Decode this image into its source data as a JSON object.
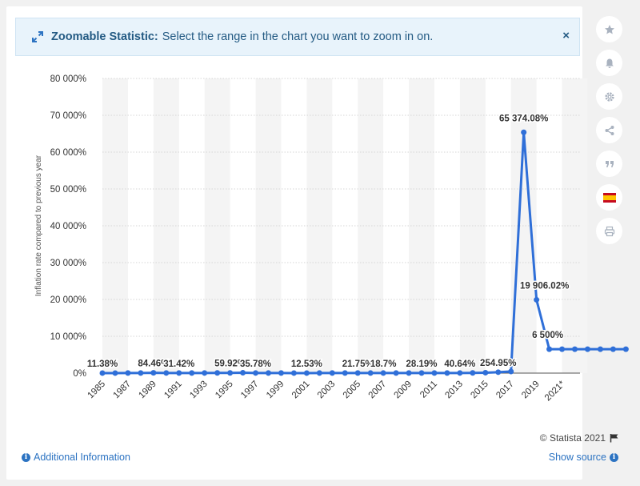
{
  "banner": {
    "title": "Zoomable Statistic:",
    "text": "Select the range in the chart you want to zoom in on.",
    "close_label": "×"
  },
  "sidebar": {
    "icons": [
      "star-icon",
      "bell-icon",
      "gear-icon",
      "share-icon",
      "quote-icon",
      "spain-flag-icon",
      "print-icon"
    ]
  },
  "footer": {
    "credit": "© Statista 2021",
    "additional_info": "Additional Information",
    "show_source": "Show source"
  },
  "colors": {
    "line": "#2f6fd8",
    "band": "#f4f4f4",
    "grid": "#d6d6d6",
    "banner_text": "#235a83",
    "link": "#2c73c2"
  },
  "chart_data": {
    "type": "line",
    "ylabel": "Inflation rate compared to previous year",
    "ylim": [
      0,
      80000
    ],
    "yticks": [
      "0%",
      "10 000%",
      "20 000%",
      "30 000%",
      "40 000%",
      "50 000%",
      "60 000%",
      "70 000%",
      "80 000%"
    ],
    "xtick_labels": [
      "1985",
      "1987",
      "1989",
      "1991",
      "1993",
      "1995",
      "1997",
      "1999",
      "2001",
      "2003",
      "2005",
      "2007",
      "2009",
      "2011",
      "2013",
      "2015",
      "2017",
      "2019",
      "2021*"
    ],
    "categories": [
      "1985",
      "1986",
      "1987",
      "1988",
      "1989",
      "1990",
      "1991",
      "1992",
      "1993",
      "1994",
      "1995",
      "1996",
      "1997",
      "1998",
      "1999",
      "2000",
      "2001",
      "2002",
      "2003",
      "2004",
      "2005",
      "2006",
      "2007",
      "2008",
      "2009",
      "2010",
      "2011",
      "2012",
      "2013",
      "2014",
      "2015",
      "2016",
      "2017",
      "2018",
      "2019",
      "2020",
      "2021",
      "2022",
      "2023",
      "2024",
      "2025",
      "2026"
    ],
    "values": [
      11.38,
      11.5,
      28.1,
      29.5,
      84.46,
      40.7,
      31.42,
      31.4,
      38.1,
      60.8,
      59.92,
      99.9,
      35.78,
      22.5,
      20.0,
      13.4,
      12.53,
      22.4,
      31.1,
      21.7,
      21.75,
      17.0,
      18.7,
      30.4,
      27.1,
      28.19,
      26.1,
      21.1,
      40.64,
      62.2,
      121.7,
      254.95,
      438.1,
      65374.08,
      19906.02,
      6500,
      6500,
      6500,
      6500,
      6500,
      6500,
      6500
    ],
    "data_labels": [
      {
        "index": 0,
        "text": "11.38%"
      },
      {
        "index": 4,
        "text": "84.46%"
      },
      {
        "index": 6,
        "text": "31.42%"
      },
      {
        "index": 10,
        "text": "59.92%"
      },
      {
        "index": 12,
        "text": "35.78%"
      },
      {
        "index": 16,
        "text": "12.53%"
      },
      {
        "index": 20,
        "text": "21.75%"
      },
      {
        "index": 22,
        "text": "18.7%"
      },
      {
        "index": 25,
        "text": "28.19%"
      },
      {
        "index": 28,
        "text": "40.64%"
      },
      {
        "index": 31,
        "text": "254.95%"
      },
      {
        "index": 33,
        "text": "65 374.08%"
      },
      {
        "index": 34,
        "text": "19 906.02%"
      },
      {
        "index": 35,
        "text": "6 500%"
      }
    ],
    "grid": true,
    "legend": "none"
  }
}
